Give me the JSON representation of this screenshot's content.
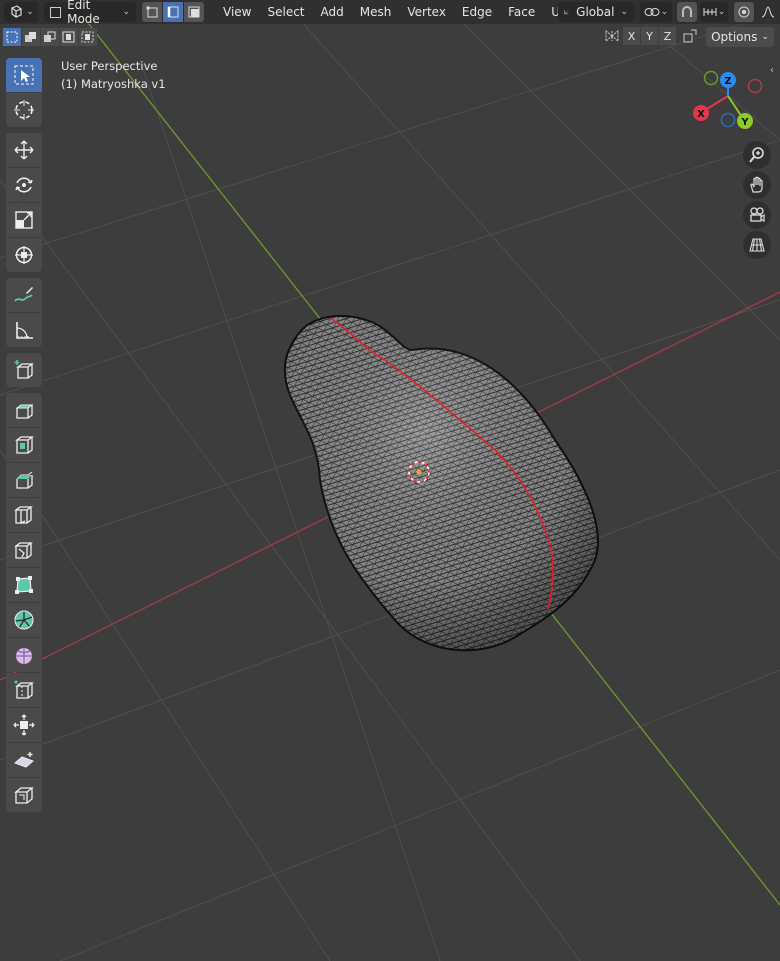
{
  "header": {
    "mode": "Edit Mode",
    "menus": [
      "View",
      "Select",
      "Add",
      "Mesh",
      "Vertex",
      "Edge",
      "Face",
      "UV"
    ],
    "transform_orientation": "Global"
  },
  "header2": {
    "axes": [
      "X",
      "Y",
      "Z"
    ],
    "options_label": "Options"
  },
  "viewport": {
    "view_name": "User Perspective",
    "object_name": "(1) Matryoshka v1"
  },
  "gizmo": {
    "z_label": "Z",
    "x_label": "X",
    "y_label": "Y",
    "colors": {
      "x": "#e8354b",
      "y": "#8bc92c",
      "z": "#2a8cf0"
    }
  },
  "tools": [
    "select-box-tool",
    "cursor-tool",
    "move-tool",
    "rotate-tool",
    "scale-tool",
    "transform-tool",
    "annotate-tool",
    "measure-tool",
    "add-cube-tool",
    "extrude-region-tool",
    "inset-faces-tool",
    "bevel-tool",
    "loop-cut-tool",
    "knife-tool",
    "poly-build-tool",
    "spin-tool",
    "smooth-tool",
    "edge-slide-tool",
    "shrink-fatten-tool",
    "shear-tool",
    "rip-region-tool"
  ]
}
